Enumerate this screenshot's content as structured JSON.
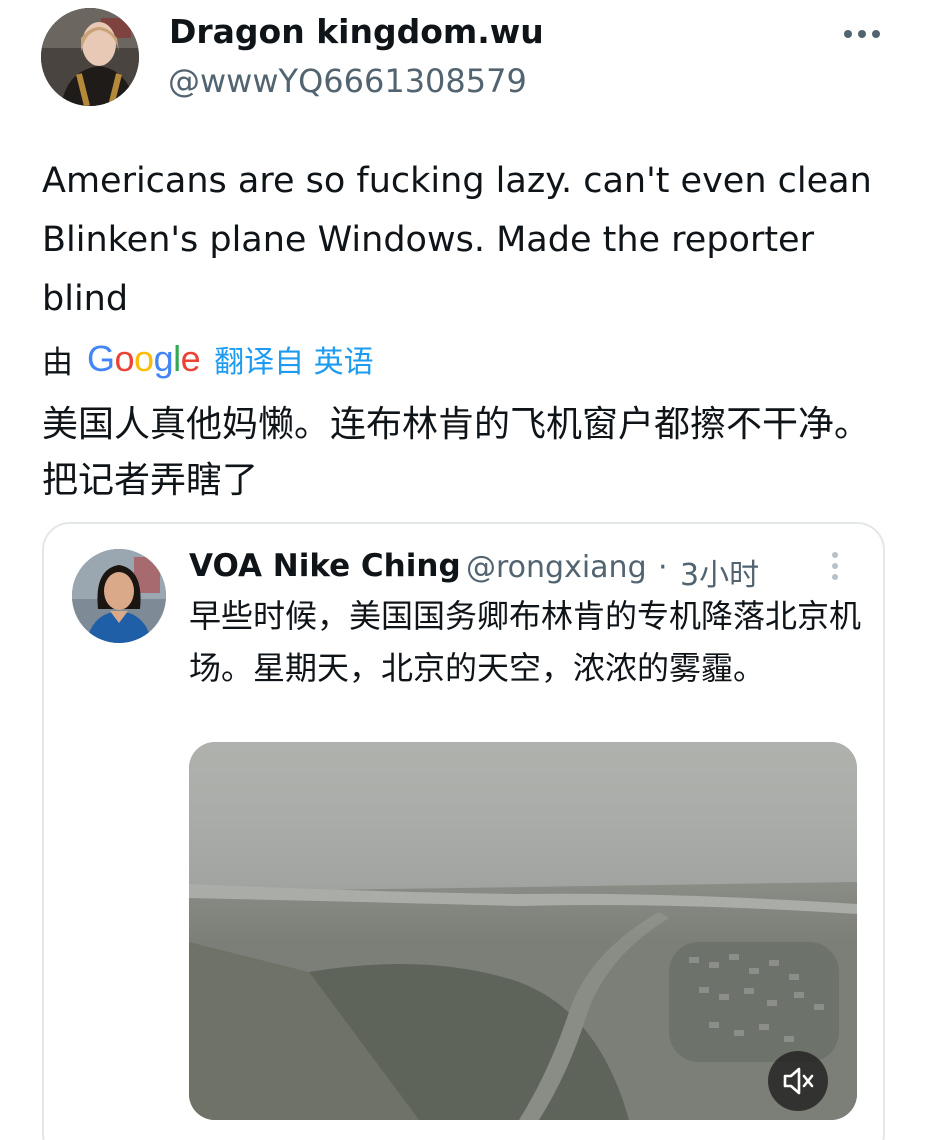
{
  "tweet": {
    "display_name": "Dragon kingdom.wu",
    "handle": "@wwwYQ6661308579",
    "text": "Americans are so fucking lazy. can't even clean Blinken's plane Windows. Made the reporter blind",
    "more_icon": "more-horizontal-icon"
  },
  "translation": {
    "by_label": "由",
    "provider": "Google",
    "provider_letters": [
      "G",
      "o",
      "o",
      "g",
      "l",
      "e"
    ],
    "provider_colors": [
      "#4285f4",
      "#ea4335",
      "#fbbc05",
      "#4285f4",
      "#34a853",
      "#ea4335"
    ],
    "link_label": "翻译自 英语",
    "text": "美国人真他妈懒。连布林肯的飞机窗户都擦不干净。把记者弄瞎了"
  },
  "quoted_tweet": {
    "display_name": "VOA Nike Ching",
    "handle": "@rongxiang",
    "separator": "·",
    "time": "3小时",
    "text": "早些时候，美国国务卿布林肯的专机降落北京机场。星期天，北京的天空，浓浓的雾霾。",
    "media_icon": "video-thumbnail",
    "mute_icon": "volume-muted-icon"
  },
  "colors": {
    "text_primary": "#0f1419",
    "text_secondary": "#536471",
    "link": "#1d9bf0",
    "border": "#e3e7ea"
  }
}
